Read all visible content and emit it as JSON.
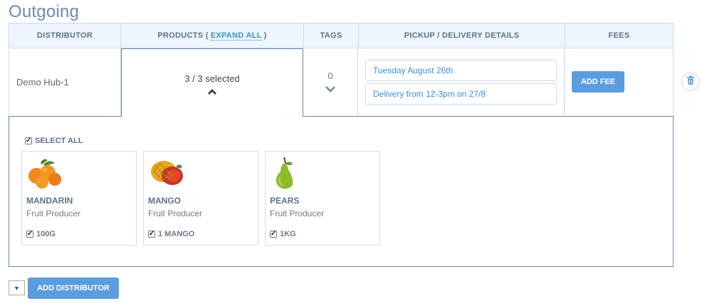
{
  "page": {
    "title": "Outgoing"
  },
  "table": {
    "headers": {
      "distributor": "DISTRIBUTOR",
      "products_prefix": "PRODUCTS (",
      "expand_all": "EXPAND ALL",
      "products_suffix": ")",
      "tags": "TAGS",
      "pickup": "PICKUP / DELIVERY DETAILS",
      "fees": "FEES"
    },
    "row": {
      "distributor": "Demo Hub-1",
      "products_selected": "3 / 3 selected",
      "tags_count": "0",
      "pickup_time": "Tuesday August 26th",
      "pickup_instructions": "Delivery from 12-3pm on 27/8",
      "add_fee_label": "ADD FEE"
    }
  },
  "products_panel": {
    "select_all_label": "SELECT ALL",
    "products": [
      {
        "name": "MANDARIN",
        "producer": "Fruit Producer",
        "unit": "100G",
        "icon": "mandarin-image"
      },
      {
        "name": "MANGO",
        "producer": "Fruit Producer",
        "unit": "1 MANGO",
        "icon": "mango-image"
      },
      {
        "name": "PEARS",
        "producer": "Fruit Producer",
        "unit": "1KG",
        "icon": "pear-image"
      }
    ]
  },
  "footer": {
    "add_distributor_label": "ADD DISTRIBUTOR"
  },
  "colors": {
    "accent": "#5a9ce0",
    "title": "#6c8caf",
    "header_bg": "#eef5fc",
    "border": "#c8dbea"
  }
}
